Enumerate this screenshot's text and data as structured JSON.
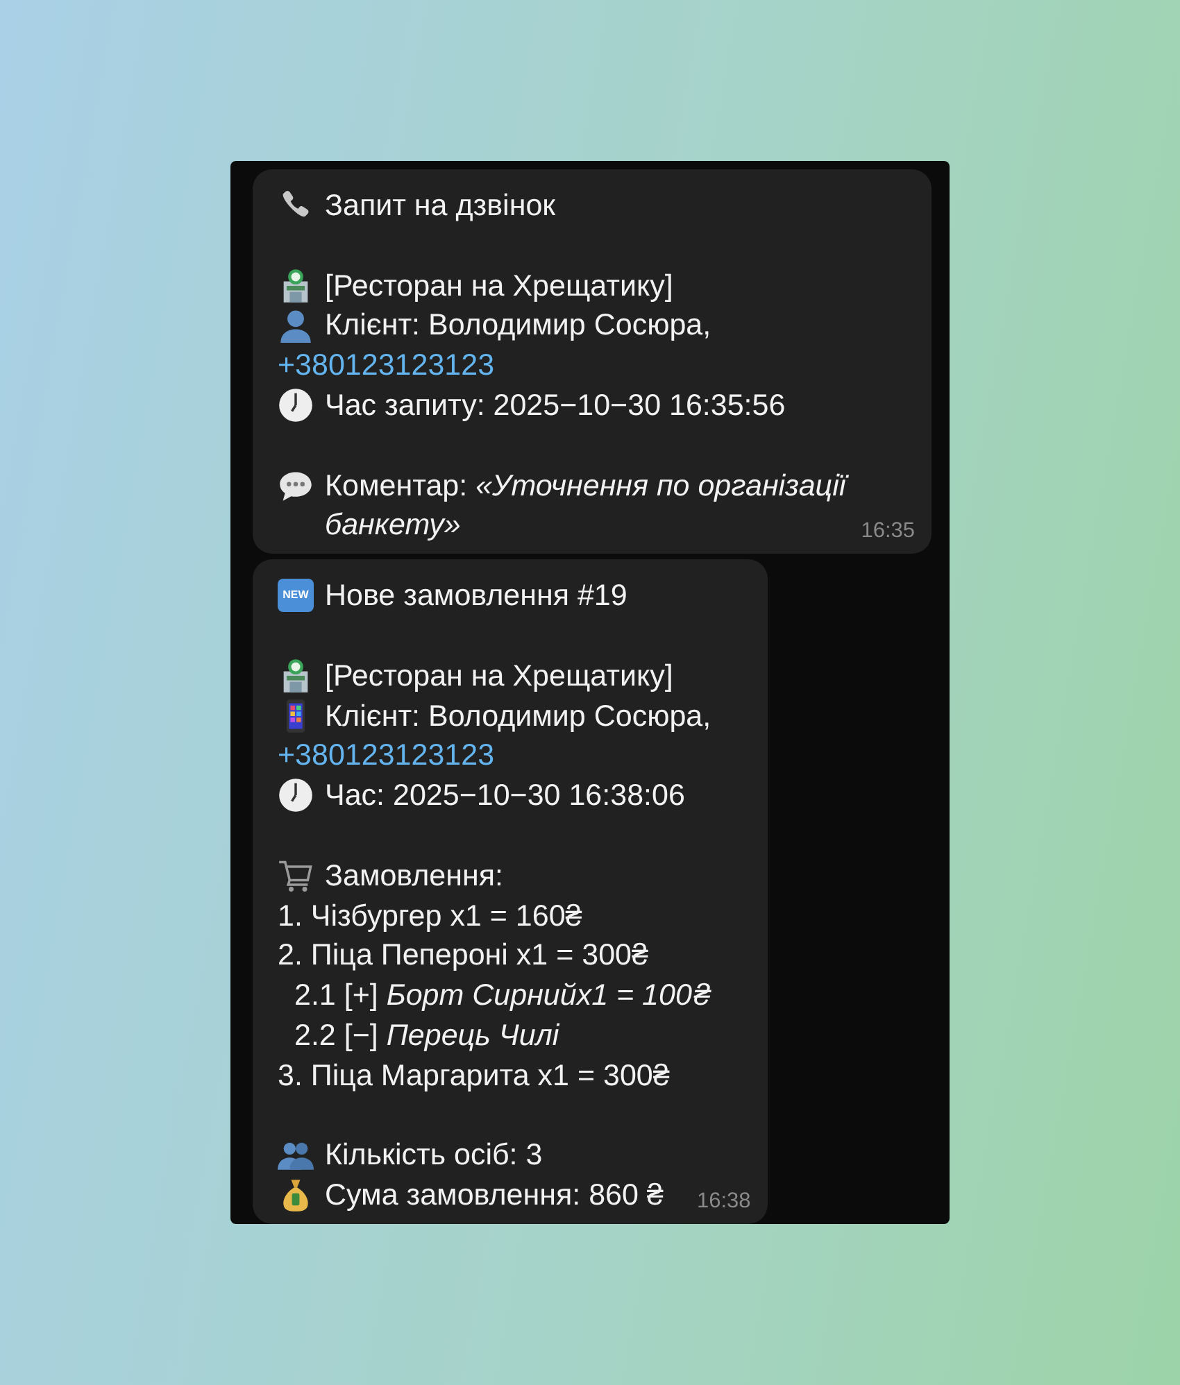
{
  "messages": [
    {
      "time": "16:35",
      "lines": [
        {
          "kind": "call",
          "text": "Запит на дзвінок"
        },
        {
          "kind": "blank"
        },
        {
          "kind": "venue",
          "text": "[Ресторан на Хрещатику]"
        },
        {
          "kind": "contact",
          "text": "Клієнт: Володимир Сосюра,"
        },
        {
          "kind": "link",
          "text": "+380123123123"
        },
        {
          "kind": "time",
          "text": "Час запиту: 2025−10−30 16:35:56"
        },
        {
          "kind": "blank"
        },
        {
          "kind": "comment",
          "text": "Коментар: *«Уточнення по організації банкету»*"
        }
      ]
    },
    {
      "time": "16:38",
      "lines": [
        {
          "kind": "order",
          "badge": "NEW",
          "text": "Нове замовлення #19"
        },
        {
          "kind": "blank"
        },
        {
          "kind": "venue",
          "text": "[Ресторан на Хрещатику]"
        },
        {
          "kind": "mobile",
          "text": "Клієнт: Володимир Сосюра,"
        },
        {
          "kind": "link",
          "text": "+380123123123"
        },
        {
          "kind": "time",
          "text": "Час: 2025−10−30 16:38:06"
        },
        {
          "kind": "blank"
        },
        {
          "kind": "cart",
          "text": "Замовлення:"
        },
        {
          "kind": "item",
          "text": "1. Чізбургер x1 = 160₴"
        },
        {
          "kind": "item",
          "text": "2. Піца Пепероні x1 = 300₴"
        },
        {
          "kind": "subitem",
          "text": "2.1 [+] *Борт Сирнийx1 = 100₴*"
        },
        {
          "kind": "subitem",
          "text": "2.2 [−] *Перець Чилі*"
        },
        {
          "kind": "item",
          "text": "3. Піца Маргарита x1 = 300₴"
        },
        {
          "kind": "blank"
        },
        {
          "kind": "guests",
          "text": "Кількість осіб: 3"
        },
        {
          "kind": "total",
          "text": "Сума замовлення: 860 ₴"
        }
      ]
    }
  ]
}
